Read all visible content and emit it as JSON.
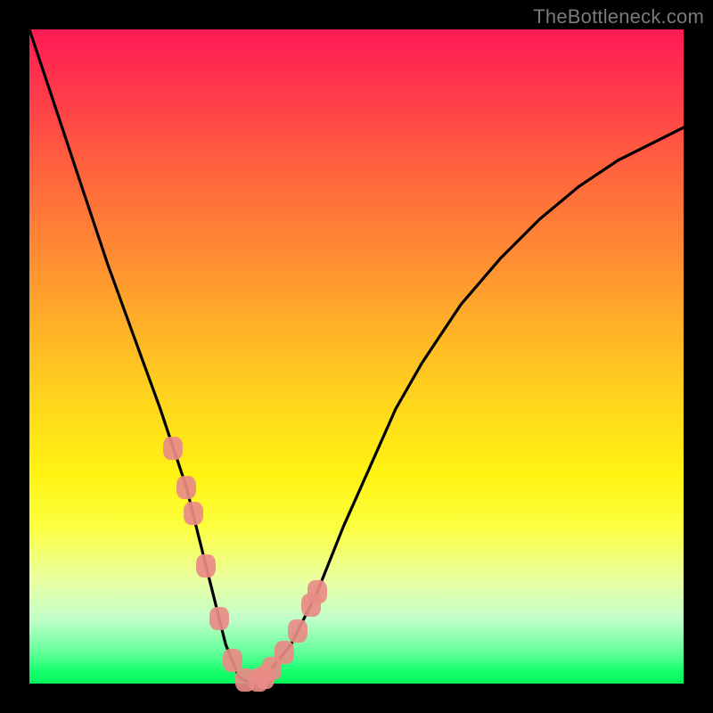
{
  "watermark": "TheBottleneck.com",
  "chart_data": {
    "type": "line",
    "title": "",
    "xlabel": "",
    "ylabel": "",
    "xlim": [
      0,
      100
    ],
    "ylim": [
      0,
      100
    ],
    "grid": false,
    "legend": false,
    "series": [
      {
        "name": "bottleneck-curve",
        "x": [
          0,
          4,
          8,
          12,
          16,
          20,
          24,
          26,
          28,
          30,
          32,
          34,
          36,
          40,
          44,
          48,
          52,
          56,
          60,
          66,
          72,
          78,
          84,
          90,
          96,
          100
        ],
        "y": [
          100,
          88,
          76,
          64,
          53,
          42,
          30,
          22,
          14,
          6,
          1,
          0,
          1,
          6,
          14,
          24,
          33,
          42,
          49,
          58,
          65,
          71,
          76,
          80,
          83,
          85
        ],
        "color": "#000000"
      }
    ],
    "markers": {
      "name": "highlight-nodes",
      "uses_curve": "bottleneck-curve",
      "x": [
        22,
        24,
        25,
        27,
        29,
        31,
        33,
        35,
        36,
        37,
        39,
        41,
        43,
        44
      ],
      "color": "#e98b85"
    },
    "background_gradient": {
      "type": "vertical",
      "stops": [
        {
          "pos": 0.0,
          "color": "#ff1a54"
        },
        {
          "pos": 0.5,
          "color": "#ffd91b"
        },
        {
          "pos": 0.8,
          "color": "#fcff40"
        },
        {
          "pos": 1.0,
          "color": "#00f75a"
        }
      ]
    }
  }
}
